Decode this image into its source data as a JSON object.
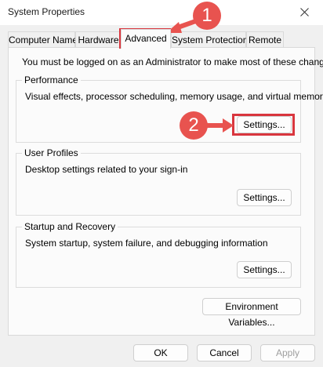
{
  "window": {
    "title": "System Properties"
  },
  "tabs": [
    {
      "label": "Computer Name"
    },
    {
      "label": "Hardware"
    },
    {
      "label": "Advanced",
      "active": true
    },
    {
      "label": "System Protection"
    },
    {
      "label": "Remote"
    }
  ],
  "notice": "You must be logged on as an Administrator to make most of these changes.",
  "performance": {
    "title": "Performance",
    "description": "Visual effects, processor scheduling, memory usage, and virtual memory",
    "button": "Settings..."
  },
  "user_profiles": {
    "title": "User Profiles",
    "description": "Desktop settings related to your sign-in",
    "button": "Settings..."
  },
  "startup_recovery": {
    "title": "Startup and Recovery",
    "description": "System startup, system failure, and debugging information",
    "button": "Settings..."
  },
  "environment_button": "Environment Variables...",
  "footer": {
    "ok": "OK",
    "cancel": "Cancel",
    "apply": "Apply"
  },
  "annotations": {
    "step1": "1",
    "step2": "2",
    "highlight_color": "#d9363e",
    "badge_color": "#e8534f"
  }
}
